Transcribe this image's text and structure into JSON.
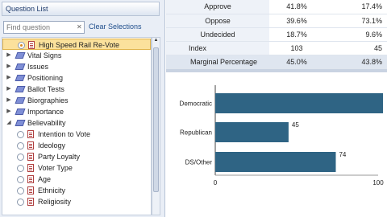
{
  "panel": {
    "header": "Question List",
    "search_placeholder": "Find question",
    "search_clear": "✕",
    "clear_selections": "Clear Selections"
  },
  "tree": [
    {
      "label": "High Speed Rail Re-Vote",
      "kind": "question",
      "selected": true,
      "checked": true
    },
    {
      "label": "Vital Signs",
      "kind": "group"
    },
    {
      "label": "Issues",
      "kind": "group"
    },
    {
      "label": "Positioning",
      "kind": "group"
    },
    {
      "label": "Ballot Tests",
      "kind": "group"
    },
    {
      "label": "Biorgraphies",
      "kind": "group"
    },
    {
      "label": "Importance",
      "kind": "group"
    },
    {
      "label": "Believability",
      "kind": "group"
    },
    {
      "label": "Intention to Vote",
      "kind": "question"
    },
    {
      "label": "Ideology",
      "kind": "question"
    },
    {
      "label": "Party Loyalty",
      "kind": "question"
    },
    {
      "label": "Voter Type",
      "kind": "question"
    },
    {
      "label": "Age",
      "kind": "question"
    },
    {
      "label": "Ethnicity",
      "kind": "question"
    },
    {
      "label": "Religiosity",
      "kind": "question"
    }
  ],
  "table": {
    "rows": [
      {
        "label": "Approve",
        "a": "41.8%",
        "b": "17.4%"
      },
      {
        "label": "Oppose",
        "a": "39.6%",
        "b": "73.1%"
      },
      {
        "label": "Undecided",
        "a": "18.7%",
        "b": "9.6%"
      },
      {
        "label": "Index",
        "a": "103",
        "b": "45"
      },
      {
        "label": "Marginal Percentage",
        "a": "45.0%",
        "b": "43.8%"
      }
    ]
  },
  "chart_data": {
    "type": "bar",
    "orientation": "horizontal",
    "categories": [
      "Democratic",
      "Republican",
      "DS/Other"
    ],
    "values": [
      103,
      45,
      74
    ],
    "data_labels": [
      "",
      "45",
      "74"
    ],
    "xlim": [
      0,
      100
    ],
    "xticks": [
      "0",
      "100"
    ],
    "title": "",
    "xlabel": "",
    "ylabel": "",
    "bar_color": "#2f6484"
  },
  "colors": {
    "selected_row": "#fbe19c",
    "panel_bg": "#e9eef6",
    "accent_text": "#1f4e8c"
  }
}
